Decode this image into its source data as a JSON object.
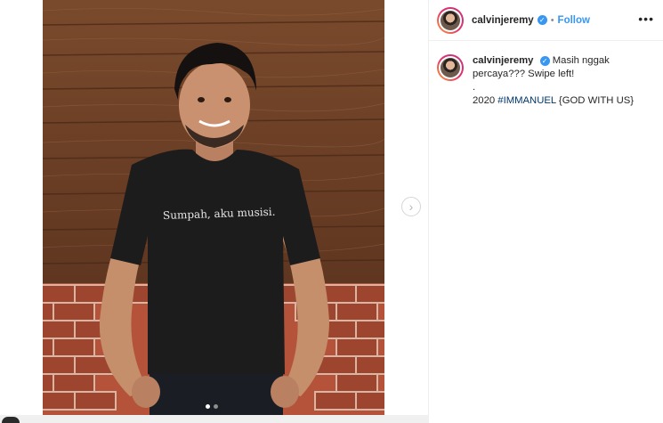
{
  "post": {
    "username": "calvinjeremy",
    "follow_label": "Follow",
    "separator": "•",
    "more_label": "•••",
    "media": {
      "shirt_text": "Sumpah, aku musisi.",
      "next_arrow": "›",
      "slide_count": 2,
      "active_slide": 1
    },
    "caption": {
      "username": "calvinjeremy",
      "text_part1": "Masih nggak percaya??? Swipe left!",
      "text_dot": ".",
      "year": "2020",
      "hashtag": "#IMMANUEL",
      "tail": "{GOD WITH US}"
    },
    "icons": {
      "verified": "verified-badge-icon",
      "more": "more-options-icon",
      "next": "chevron-right-icon"
    },
    "colors": {
      "accent": "#3897f0",
      "hashtag": "#00376b",
      "text": "#262626"
    }
  }
}
